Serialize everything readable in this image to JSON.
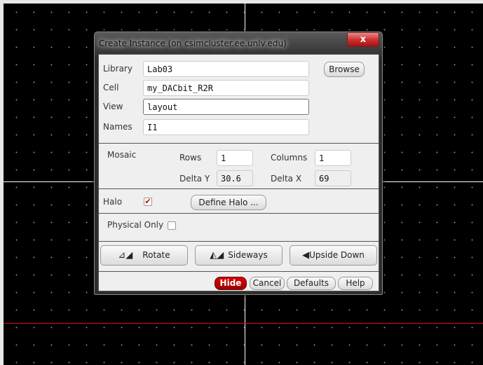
{
  "dialog": {
    "title": "Create Instance (on csimcluster.ee.unlv.edu)",
    "close_label": "x"
  },
  "form": {
    "library_label": "Library",
    "library_value": "Lab03",
    "cell_label": "Cell",
    "cell_value": "my_DACbit_R2R",
    "view_label": "View",
    "view_value": "layout",
    "names_label": "Names",
    "names_value": "I1",
    "browse_label": "Browse"
  },
  "mosaic": {
    "label": "Mosaic",
    "rows_label": "Rows",
    "rows_value": "1",
    "columns_label": "Columns",
    "columns_value": "1",
    "delta_y_label": "Delta Y",
    "delta_y_value": "30.6",
    "delta_x_label": "Delta X",
    "delta_x_value": "69"
  },
  "halo": {
    "label": "Halo",
    "checked": true,
    "check_glyph": "✔",
    "define_label": "Define Halo ..."
  },
  "physical_only": {
    "label": "Physical Only",
    "checked": false
  },
  "transforms": {
    "rotate": "Rotate",
    "sideways": "Sideways",
    "upside_down": "Upside Down"
  },
  "footer": {
    "hide": "Hide",
    "cancel": "Cancel",
    "defaults": "Defaults",
    "help": "Help"
  },
  "colors": {
    "hide_button": "#b00000",
    "crosshair_red": "#e01010"
  }
}
